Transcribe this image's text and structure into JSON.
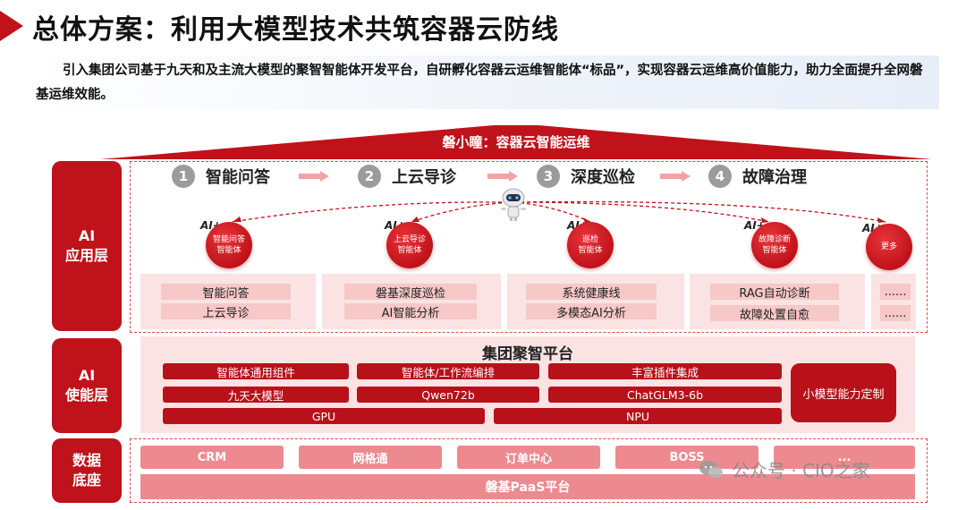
{
  "header": {
    "title": "总体方案：利用大模型技术共筑容器云防线",
    "intro": "引入集团公司基于九天和及主流大模型的聚智智能体开发平台，自研孵化容器云运维智能体“标品”，实现容器云运维高价值能力，助力全面提升全网磐基运维效能。"
  },
  "roof_label": "磐小瞳：容器云智能运维",
  "layers": {
    "app": "AI\n应用层",
    "enable": "AI\n使能层",
    "data": "数据\n底座"
  },
  "steps": [
    {
      "num": "1",
      "label": "智能问答"
    },
    {
      "num": "2",
      "label": "上云导诊"
    },
    {
      "num": "3",
      "label": "深度巡检"
    },
    {
      "num": "4",
      "label": "故障治理"
    }
  ],
  "ai_plus": "AI+",
  "agents": [
    {
      "label": "智能问答\n智能体"
    },
    {
      "label": "上云导诊\n智能体"
    },
    {
      "label": "巡检\n智能体"
    },
    {
      "label": "故障诊断\n智能体"
    },
    {
      "label": "更多"
    }
  ],
  "app_items": [
    [
      "智能问答",
      "上云导诊"
    ],
    [
      "磐基深度巡检",
      "AI智能分析"
    ],
    [
      "系统健康线",
      "多模态AI分析"
    ],
    [
      "RAG自动诊断",
      "故障处置自愈"
    ],
    [
      "......",
      "......"
    ]
  ],
  "enable": {
    "platform_title": "集团聚智平台",
    "row1": [
      "智能体通用组件",
      "智能体/工作流编排",
      "丰富插件集成"
    ],
    "row2": [
      "九天大模型",
      "Qwen72b",
      "ChatGLM3-6b"
    ],
    "row3": [
      "GPU",
      "NPU"
    ],
    "small_model": "小模型能力定制"
  },
  "data_layer": {
    "items": [
      "CRM",
      "网格通",
      "订单中心",
      "BOSS",
      "..."
    ],
    "paas": "磐基PaaS平台"
  },
  "watermark": "公众号 · CIO之家",
  "colors": {
    "brand_red": "#c0121a",
    "light_pink": "#fbe3e3",
    "mid_pink": "#ec8a8f"
  }
}
